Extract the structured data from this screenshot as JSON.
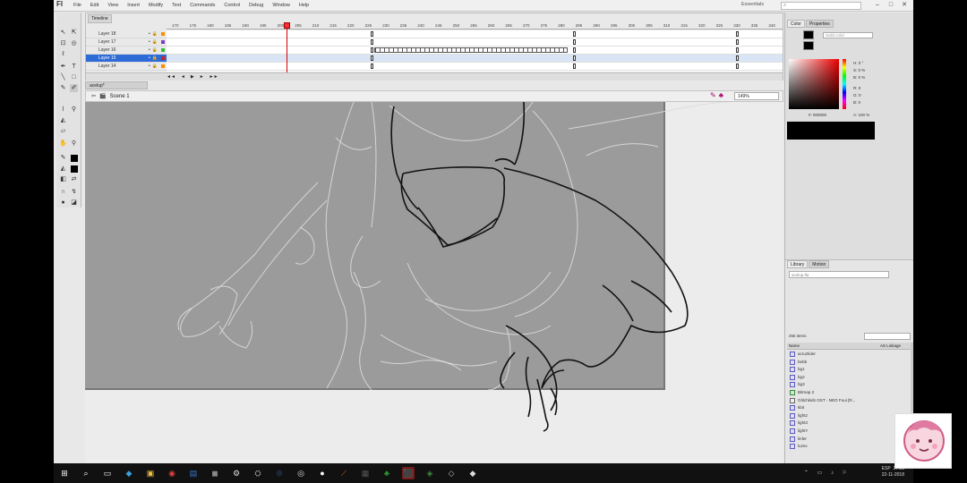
{
  "app": {
    "logo": "Fl"
  },
  "menu": [
    "File",
    "Edit",
    "View",
    "Insert",
    "Modify",
    "Text",
    "Commands",
    "Control",
    "Debug",
    "Window",
    "Help"
  ],
  "workspace": "Essentials",
  "window_controls": [
    "–",
    "□",
    "✕"
  ],
  "timeline": {
    "tab_label": "Timeline",
    "layers": [
      {
        "name": "Layer 18",
        "color": "#ff8c00"
      },
      {
        "name": "Layer 17",
        "color": "#7b3fbf"
      },
      {
        "name": "Layer 16",
        "color": "#2fbf2f"
      },
      {
        "name": "Layer 15",
        "color": "#d02020"
      },
      {
        "name": "Layer 14",
        "color": "#ff8c00"
      }
    ],
    "selected_layer_index": 3,
    "ruler_ticks": [
      "170",
      "175",
      "180",
      "185",
      "190",
      "195",
      "200",
      "205",
      "210",
      "215",
      "220",
      "225",
      "230",
      "235",
      "240",
      "245",
      "250",
      "255",
      "260",
      "265",
      "270",
      "275",
      "280",
      "285",
      "290",
      "295",
      "300",
      "305",
      "310",
      "315",
      "320",
      "325",
      "330",
      "335",
      "340"
    ],
    "footer": [
      "◄◄",
      "◄",
      "▶",
      "►",
      "►►"
    ]
  },
  "document_tab": "acelup*",
  "scene_label": "Scene 1",
  "zoom": "149%",
  "right_panel": {
    "color_tabs": [
      "Color",
      "Properties"
    ],
    "fill_type": "Solid color",
    "hsb": [
      "H: 0 °",
      "S: 0 %",
      "B: 0 %"
    ],
    "rgb": [
      "R: 0",
      "G: 0",
      "B: 0"
    ],
    "hex": "#: 000000",
    "alpha": "A: 100 %",
    "library_tabs": [
      "Library",
      "Motion"
    ],
    "library_doc": "acelup.fla",
    "library_count": "255 items",
    "library_columns": [
      "Name",
      "AS Linkage"
    ],
    "library_items": [
      {
        "name": "acruzlider",
        "type": "sym"
      },
      {
        "name": "bebb",
        "type": "sym"
      },
      {
        "name": "bg1",
        "type": "sym"
      },
      {
        "name": "bg2",
        "type": "sym"
      },
      {
        "name": "bg3",
        "type": "sym"
      },
      {
        "name": "Bitmap 2",
        "type": "bmp"
      },
      {
        "name": "Glitchkids OST - NEO Fuui [R...",
        "type": "snd"
      },
      {
        "name": "kbit",
        "type": "sym"
      },
      {
        "name": "light2",
        "type": "sym"
      },
      {
        "name": "light3",
        "type": "sym"
      },
      {
        "name": "lightY",
        "type": "sym"
      },
      {
        "name": "linfer",
        "type": "sym"
      },
      {
        "name": "luzex",
        "type": "sym"
      }
    ]
  },
  "taskbar": {
    "icons": [
      "⊞",
      "⌕",
      "▭",
      "◆",
      "▣",
      "◉",
      "▤",
      "◼",
      "⚙",
      "⛭",
      "⬢",
      "◎",
      "●",
      "⟋",
      "▦",
      "♣",
      "⬛",
      "◈",
      "◇",
      "◆"
    ],
    "time": "17:33",
    "date": "22-11-2018",
    "lang": "ESP"
  }
}
